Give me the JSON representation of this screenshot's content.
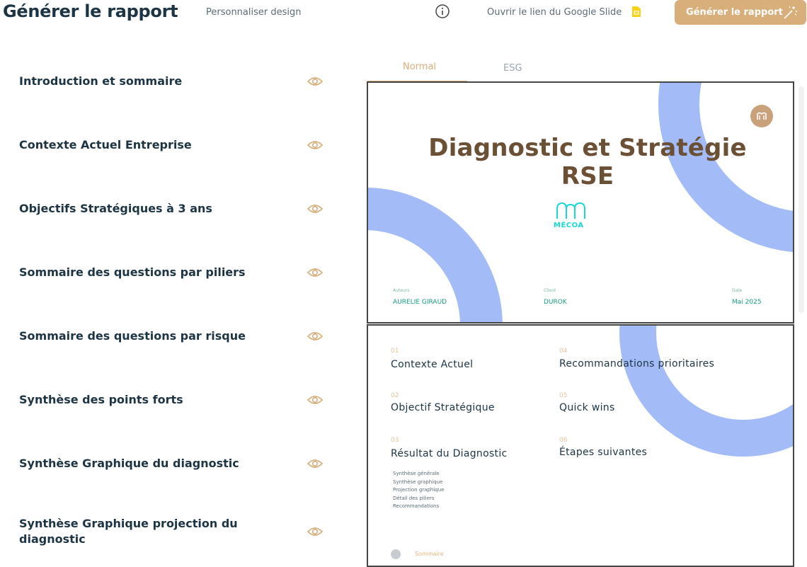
{
  "header": {
    "title": "Générer le rapport",
    "customize_link": "Personnaliser design",
    "info_icon": "info-icon",
    "google_slide_link": "Ouvrir le lien du Google Slide",
    "google_slide_icon": "google-slides-icon",
    "generate_button": "Générer le rapport",
    "generate_icon": "magic-wand-icon"
  },
  "sections": [
    {
      "label": "Introduction et sommaire",
      "icon": "eye-icon"
    },
    {
      "label": "Contexte Actuel Entreprise",
      "icon": "eye-icon"
    },
    {
      "label": "Objectifs Stratégiques à 3 ans",
      "icon": "eye-icon"
    },
    {
      "label": "Sommaire des questions par piliers",
      "icon": "eye-icon"
    },
    {
      "label": "Sommaire des questions par risque",
      "icon": "eye-icon"
    },
    {
      "label": "Synthèse des points forts",
      "icon": "eye-icon"
    },
    {
      "label": "Synthèse Graphique du diagnostic",
      "icon": "eye-icon"
    },
    {
      "label": "Synthèse Graphique projection du diagnostic",
      "icon": "eye-icon"
    }
  ],
  "tabs": [
    {
      "label": "Normal",
      "active": true
    },
    {
      "label": "ESG",
      "active": false
    }
  ],
  "slide1": {
    "title": "Diagnostic et Stratégie RSE",
    "logo_text": "MÉCOA",
    "author_label": "Auteurs",
    "author_value": "AURELIE GIRAUD",
    "client_label": "Client",
    "client_value": "DUROK",
    "date_label": "Date",
    "date_value": "Mai 2025"
  },
  "slide2": {
    "items": [
      {
        "num": "01",
        "label": "Contexte Actuel"
      },
      {
        "num": "02",
        "label": "Objectif Stratégique"
      },
      {
        "num": "03",
        "label": "Résultat du Diagnostic"
      },
      {
        "num": "04",
        "label": "Recommandations prioritaires"
      },
      {
        "num": "05",
        "label": "Quick wins"
      },
      {
        "num": "06",
        "label": "Étapes suivantes"
      }
    ],
    "subitems": [
      "Synthèse générale",
      "Synthèse graphique",
      "Projection graphique",
      "Détail des piliers",
      "Recommandations"
    ],
    "footer": "Sommaire"
  },
  "colors": {
    "accent": "#d8ae7a",
    "navy": "#1c3444",
    "arc_blue": "#a3bbf7",
    "logo_teal": "#19d8d3",
    "title_brown": "#6b5036"
  }
}
